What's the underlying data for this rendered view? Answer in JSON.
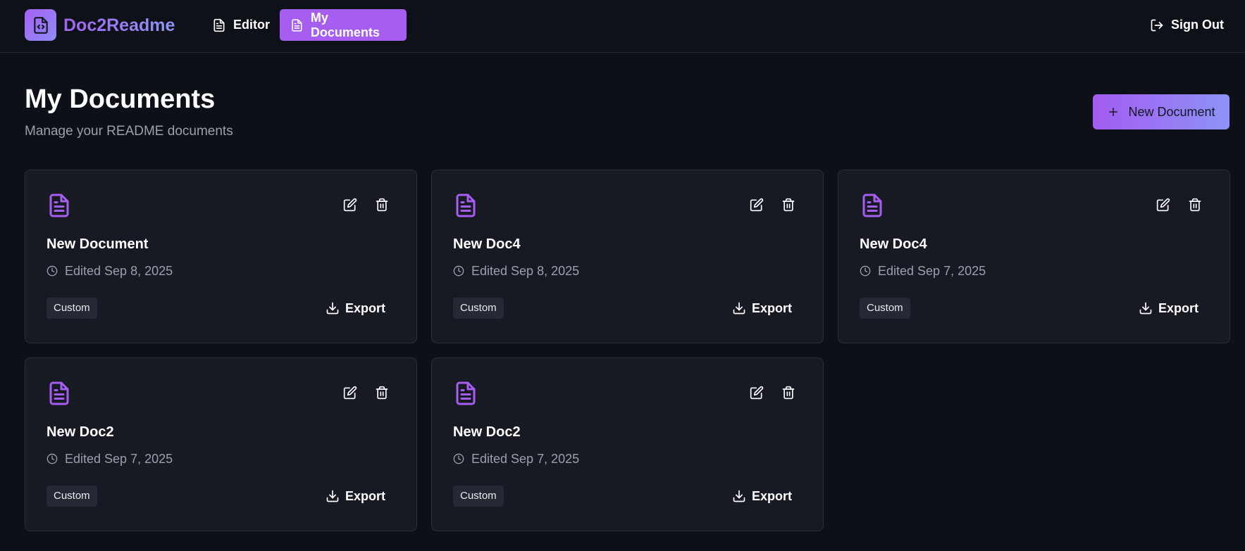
{
  "app": {
    "brand": "Doc2Readme",
    "accent": "#a65ef0",
    "accent_gradient_end": "#8d93f7"
  },
  "nav": {
    "editor_label": "Editor",
    "documents_label": "My Documents",
    "signout_label": "Sign Out"
  },
  "header": {
    "title": "My Documents",
    "subtitle": "Manage your README documents",
    "new_button_label": "New Document"
  },
  "documents": [
    {
      "title": "New Document",
      "edited": "Edited Sep 8, 2025",
      "tag": "Custom",
      "export_label": "Export"
    },
    {
      "title": "New Doc4",
      "edited": "Edited Sep 8, 2025",
      "tag": "Custom",
      "export_label": "Export"
    },
    {
      "title": "New Doc4",
      "edited": "Edited Sep 7, 2025",
      "tag": "Custom",
      "export_label": "Export"
    },
    {
      "title": "New Doc2",
      "edited": "Edited Sep 7, 2025",
      "tag": "Custom",
      "export_label": "Export"
    },
    {
      "title": "New Doc2",
      "edited": "Edited Sep 7, 2025",
      "tag": "Custom",
      "export_label": "Export"
    }
  ],
  "icons": {
    "logo": "code-file-icon",
    "nav_editor": "file-text-icon",
    "nav_documents": "file-text-icon",
    "signout": "logout-icon",
    "new_document": "plus-icon",
    "document": "file-text-icon",
    "edit": "edit-icon",
    "delete": "trash-icon",
    "edited": "clock-icon",
    "export": "download-icon"
  }
}
